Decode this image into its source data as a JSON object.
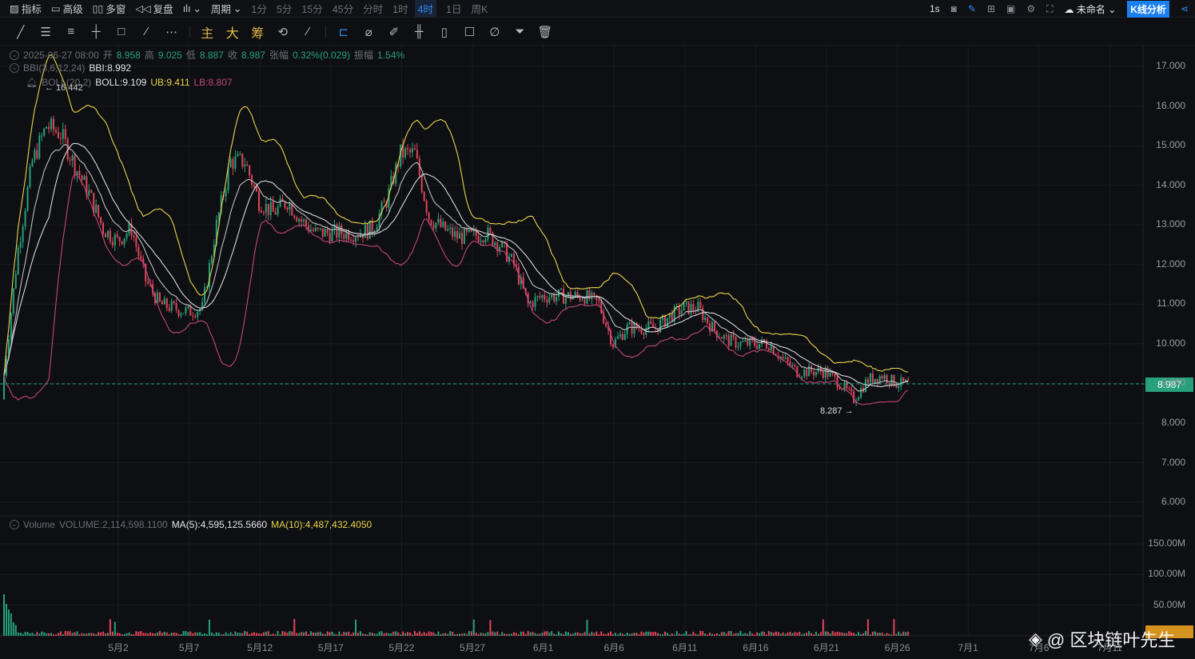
{
  "topbar": {
    "items": [
      {
        "icon": "indicator-icon",
        "label": "指标"
      },
      {
        "icon": "advanced-icon",
        "label": "高级"
      },
      {
        "icon": "multiwindow-icon",
        "label": "多窗"
      },
      {
        "icon": "replay-icon",
        "label": "复盘"
      }
    ],
    "chart_type_icon": "candle-type-icon",
    "period_label": "周期",
    "periods": [
      "1分",
      "5分",
      "15分",
      "45分",
      "分时",
      "1时",
      "4时",
      "1日",
      "周K"
    ],
    "active_period": "4时",
    "refresh": "1s",
    "layout_name": "未命名",
    "analysis_button": "K线分析"
  },
  "toolbar": {
    "tools": [
      "line-tool-icon",
      "parallel-channel-icon",
      "horizontal-lines-icon",
      "cross-line-icon",
      "rectangle-icon",
      "pen-brush-icon",
      "more-icon"
    ],
    "text_tools": [
      "主",
      "大",
      "筹"
    ],
    "right_tools": [
      "magnet-icon",
      "brush-icon",
      "bookmark-icon",
      "ruler-icon",
      "draw-icon",
      "candle-compare-icon",
      "lock-icon",
      "note-icon",
      "clip-icon",
      "filter-icon",
      "trash-icon"
    ]
  },
  "ohlc": {
    "datetime": "2025-06-27 08:00",
    "open_label": "开",
    "open": "8.958",
    "high_label": "高",
    "high": "9.025",
    "low_label": "低",
    "low": "8.887",
    "close_label": "收",
    "close": "8.987",
    "change_label": "张幅",
    "change": "0.32%(0.029)",
    "amp_label": "振幅",
    "amp": "1.54%"
  },
  "bbi": {
    "name": "BBI(3,6,12,24)",
    "value": "BBI:8.992"
  },
  "boll": {
    "name": "BOLL(20,2)",
    "mid": "BOLL:9.109",
    "ub": "UB:9.411",
    "lb": "LB:8.807"
  },
  "volume": {
    "name": "Volume",
    "value": "VOLUME:2,114,598.1100",
    "ma5": "MA(5):4,595,125.5660",
    "ma10": "MA(10):4,487,432.4050"
  },
  "markers": {
    "high": "← 16.442",
    "low": "8.287 →"
  },
  "current_price": "8.987",
  "watermark": "@ 区块链叶先生",
  "colors": {
    "up": "#26a17b",
    "down": "#e0455a",
    "ub": "#e8d44d",
    "lb": "#c0487a",
    "accent": "#2f8bf0"
  },
  "chart_data": {
    "type": "candlestick",
    "interval": "4h",
    "start_date": "2025-04-24",
    "daily_close": [
      9.2,
      12.4,
      14.6,
      15.5,
      15.3,
      14.5,
      13.8,
      12.9,
      12.6,
      12.9,
      11.6,
      11.0,
      10.9,
      10.8,
      10.9,
      13.0,
      14.6,
      14.6,
      13.6,
      13.3,
      13.6,
      13.1,
      12.8,
      12.8,
      12.8,
      12.8,
      12.9,
      13.6,
      14.8,
      14.8,
      13.2,
      12.9,
      12.7,
      12.7,
      12.8,
      12.5,
      12.0,
      11.0,
      11.2,
      11.2,
      11.2,
      11.2,
      11.0,
      10.0,
      10.4,
      10.4,
      10.4,
      10.7,
      10.9,
      10.9,
      10.4,
      10.1,
      10.0,
      10.0,
      10.0,
      9.6,
      9.3,
      9.3,
      9.3,
      9.0,
      8.6,
      9.1,
      9.2,
      9.0,
      8.99
    ],
    "y_ticks": [
      "17.000",
      "16.000",
      "15.000",
      "14.000",
      "13.000",
      "12.000",
      "11.000",
      "10.000",
      "9.000",
      "8.000",
      "7.000",
      "6.000"
    ],
    "ylim": [
      6,
      17
    ],
    "vol_ticks": [
      "150.00M",
      "100.00M",
      "50.00M"
    ],
    "x_ticks": [
      "5月2",
      "5月7",
      "5月12",
      "5月17",
      "5月22",
      "5月27",
      "6月1",
      "6月6",
      "6月11",
      "6月16",
      "6月21",
      "6月26",
      "7月1",
      "7月6",
      "7月11"
    ]
  }
}
